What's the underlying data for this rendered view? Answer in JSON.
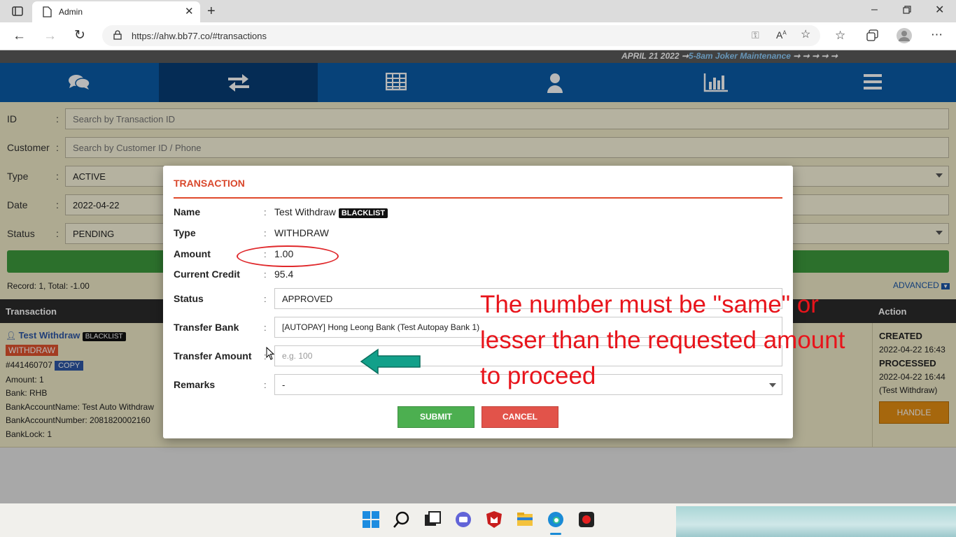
{
  "browser": {
    "tab_title": "Admin",
    "url": "https://ahw.bb77.co/#transactions"
  },
  "ticker": {
    "date": "APRIL 21 2022",
    "message": "5-8am Joker Maintenance"
  },
  "nav": {
    "items": [
      "chat-icon",
      "transfer-icon",
      "table-icon",
      "user-icon",
      "chart-icon",
      "menu-icon"
    ],
    "active_index": 1
  },
  "filters": {
    "id": {
      "label": "ID",
      "placeholder": "Search by Transaction ID"
    },
    "customer": {
      "label": "Customer",
      "placeholder": "Search by Customer ID / Phone"
    },
    "type": {
      "label": "Type",
      "value": "ACTIVE"
    },
    "date": {
      "label": "Date",
      "value": "2022-04-22"
    },
    "status": {
      "label": "Status",
      "value": "PENDING"
    }
  },
  "record_summary": "Record: 1, Total: -1.00",
  "advanced_label": "ADVANCED",
  "table": {
    "headers": {
      "transaction": "Transaction",
      "action": "Action"
    },
    "row": {
      "customer": "Test Withdraw",
      "blacklist": "BLACKLIST",
      "type_badge": "WITHDRAW",
      "txn_id": "#441460707",
      "copy_label": "COPY",
      "amount": "Amount: 1",
      "bank": "Bank: RHB",
      "account_name": "BankAccountName: Test Auto Withdraw",
      "account_number": "BankAccountNumber: 2081820002160",
      "bank_lock": "BankLock: 1",
      "created_label": "CREATED",
      "created_time": "2022-04-22 16:43",
      "processed_label": "PROCESSED",
      "processed_time": "2022-04-22 16:44",
      "processed_by": "(Test Withdraw)",
      "handle_label": "HANDLE"
    }
  },
  "modal": {
    "title": "TRANSACTION",
    "name_label": "Name",
    "name_value": "Test Withdraw",
    "blacklist": "BLACKLIST",
    "type_label": "Type",
    "type_value": "WITHDRAW",
    "amount_label": "Amount",
    "amount_value": "1.00",
    "credit_label": "Current Credit",
    "credit_value": "95.4",
    "status_label": "Status",
    "status_value": "APPROVED",
    "bank_label": "Transfer Bank",
    "bank_value": "[AUTOPAY] Hong Leong Bank (Test Autopay Bank 1)",
    "transfer_amount_label": "Transfer Amount",
    "transfer_amount_placeholder": "e.g. 100",
    "remarks_label": "Remarks",
    "remarks_value": "-",
    "submit_label": "SUBMIT",
    "cancel_label": "CANCEL"
  },
  "annotation": {
    "line1": "The number must be \"same\" or",
    "line2": "lesser than the requested amount",
    "line3": "to proceed",
    "color": "#e8141b",
    "arrow_color": "#12a08a"
  },
  "colors": {
    "nav": "#0b5ca8",
    "nav_active": "#073e77",
    "page_bg": "#f2ecc9",
    "modal_accent": "#d9472b",
    "submit": "#4caf50",
    "cancel": "#e2534a"
  }
}
